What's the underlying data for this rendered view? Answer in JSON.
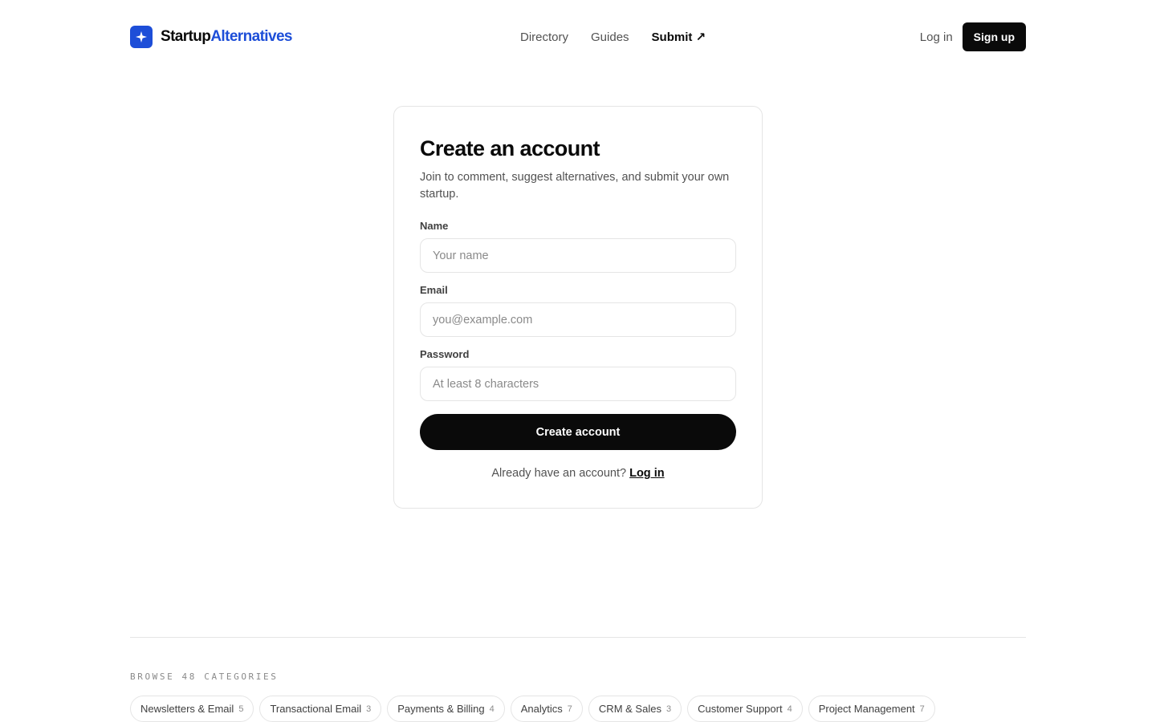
{
  "brand": {
    "name_part1": "Startup",
    "name_part2": "Alternatives",
    "logo_icon": "sparkle-icon",
    "accent_color": "#1d4ed8"
  },
  "nav": {
    "items": [
      {
        "label": "Directory"
      },
      {
        "label": "Guides"
      },
      {
        "label": "Submit ↗"
      }
    ]
  },
  "auth": {
    "login_label": "Log in",
    "signup_label": "Sign up"
  },
  "signup_form": {
    "title": "Create an account",
    "subtitle": "Join to comment, suggest alternatives, and submit your own startup.",
    "name_label": "Name",
    "name_placeholder": "Your name",
    "name_value": "",
    "email_label": "Email",
    "email_placeholder": "you@example.com",
    "email_value": "",
    "password_label": "Password",
    "password_placeholder": "At least 8 characters",
    "password_value": "",
    "submit_label": "Create account",
    "already_text": "Already have an account?",
    "login_link": "Log in"
  },
  "footer": {
    "browse_label": "BROWSE 48 CATEGORIES",
    "categories": [
      {
        "label": "Newsletters & Email",
        "count": "5"
      },
      {
        "label": "Transactional Email",
        "count": "3"
      },
      {
        "label": "Payments & Billing",
        "count": "4"
      },
      {
        "label": "Analytics",
        "count": "7"
      },
      {
        "label": "CRM & Sales",
        "count": "3"
      },
      {
        "label": "Customer Support",
        "count": "4"
      },
      {
        "label": "Project Management",
        "count": "7"
      }
    ]
  }
}
